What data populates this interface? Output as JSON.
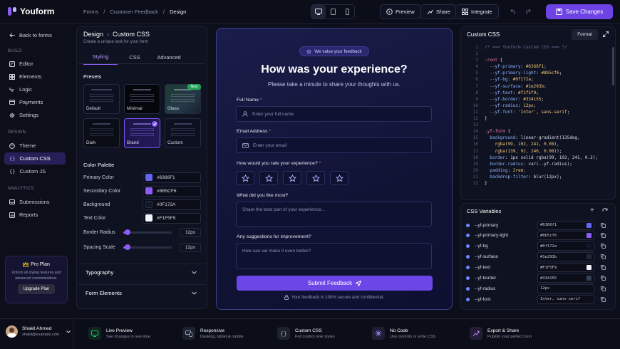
{
  "app": {
    "name": "Youform"
  },
  "breadcrumb": [
    "Forms",
    "Customer Feedback",
    "Design"
  ],
  "toolbar": {
    "preview": "Preview",
    "share": "Share",
    "integrate": "Integrate",
    "save": "Save Changes"
  },
  "sidebar": {
    "back": "Back to forms",
    "sections": {
      "build": "BUILD",
      "design": "DESIGN",
      "analytics": "ANALYTICS"
    },
    "build_items": [
      {
        "label": "Editor",
        "icon": "pencil-icon"
      },
      {
        "label": "Elements",
        "icon": "elements-icon"
      },
      {
        "label": "Logic",
        "icon": "logic-icon"
      },
      {
        "label": "Payments",
        "icon": "card-icon"
      },
      {
        "label": "Settings",
        "icon": "gear-icon"
      }
    ],
    "design_items": [
      {
        "label": "Theme",
        "icon": "palette-icon"
      },
      {
        "label": "Custom CSS",
        "icon": "braces-icon",
        "active": true
      },
      {
        "label": "Custom JS",
        "icon": "code-icon"
      }
    ],
    "analytics_items": [
      {
        "label": "Submissions",
        "icon": "inbox-icon"
      },
      {
        "label": "Reports",
        "icon": "reports-icon"
      }
    ],
    "pro": {
      "title": "Pro Plan",
      "desc1": "Unlock all styling features and",
      "desc2": "advanced customizations.",
      "button": "Upgrade Plan"
    },
    "user": {
      "name": "Shakil Ahmed",
      "email": "shakil@example.com"
    }
  },
  "design": {
    "crumb": "Design",
    "title": "Custom CSS",
    "subtitle": "Create a unique look for your form",
    "tabs": [
      "Styling",
      "CSS",
      "Advanced"
    ],
    "presets_label": "Presets",
    "presets": [
      {
        "name": "Default"
      },
      {
        "name": "Minimal"
      },
      {
        "name": "Glass",
        "badge": "New"
      },
      {
        "name": "Dark"
      },
      {
        "name": "Brand",
        "selected": true
      },
      {
        "name": "Custom"
      }
    ],
    "palette_label": "Color Palette",
    "colors": [
      {
        "name": "Primary Color",
        "hex": "#6366F1"
      },
      {
        "name": "Secondary Color",
        "hex": "#8B5CF6"
      },
      {
        "name": "Background",
        "hex": "#0F172A"
      },
      {
        "name": "Text Color",
        "hex": "#F1F5F9"
      }
    ],
    "border_radius": {
      "label": "Border Radius",
      "value": "12px",
      "fraction": 0.05
    },
    "spacing_scale": {
      "label": "Spacing Scale",
      "value": "12px",
      "fraction": 0.05
    },
    "accordions": [
      "Typography",
      "Form Elements"
    ]
  },
  "form": {
    "pill": "We value your feedback",
    "title": "How was your experience?",
    "subtitle": "Please take a minute to share your thoughts with us.",
    "name_label": "Full Name",
    "name_placeholder": "Enter your full name",
    "email_label": "Email Address",
    "email_placeholder": "Enter your email",
    "rating_label": "How would you rate your experience?",
    "rating_max": 5,
    "like_label": "What did you like most?",
    "like_placeholder": "Share the best part of your experience...",
    "improve_label": "Any suggestions for improvement?",
    "improve_placeholder": "How can we make it even better?",
    "submit": "Submit Feedback",
    "secure": "Your feedback is 100% secure and confidential.",
    "required": "*"
  },
  "css_panel": {
    "title": "Custom CSS",
    "format": "Format",
    "lines": [
      [
        {
          "t": "cm",
          "v": "/* === Youform Custom CSS === */"
        }
      ],
      [],
      [
        {
          "t": "sel",
          "v": ":root"
        },
        {
          "t": "pl",
          "v": " {"
        }
      ],
      [
        {
          "t": "prop",
          "v": "  --yf-primary"
        },
        {
          "t": "pl",
          "v": ": "
        },
        {
          "t": "val",
          "v": "#6366f1"
        },
        {
          "t": "pl",
          "v": ";"
        }
      ],
      [
        {
          "t": "prop",
          "v": "  --yf-primary-light"
        },
        {
          "t": "pl",
          "v": ": "
        },
        {
          "t": "val",
          "v": "#8b5cf6"
        },
        {
          "t": "pl",
          "v": ";"
        }
      ],
      [
        {
          "t": "prop",
          "v": "  --yf-bg"
        },
        {
          "t": "pl",
          "v": ": "
        },
        {
          "t": "val",
          "v": "#0f172a"
        },
        {
          "t": "pl",
          "v": ";"
        }
      ],
      [
        {
          "t": "prop",
          "v": "  --yf-surface"
        },
        {
          "t": "pl",
          "v": ": "
        },
        {
          "t": "val",
          "v": "#1e293b"
        },
        {
          "t": "pl",
          "v": ";"
        }
      ],
      [
        {
          "t": "prop",
          "v": "  --yf-text"
        },
        {
          "t": "pl",
          "v": ": "
        },
        {
          "t": "val",
          "v": "#f1f5f9"
        },
        {
          "t": "pl",
          "v": ";"
        }
      ],
      [
        {
          "t": "prop",
          "v": "  --yf-border"
        },
        {
          "t": "pl",
          "v": ": "
        },
        {
          "t": "val",
          "v": "#334155"
        },
        {
          "t": "pl",
          "v": ";"
        }
      ],
      [
        {
          "t": "prop",
          "v": "  --yf-radius"
        },
        {
          "t": "pl",
          "v": ": "
        },
        {
          "t": "val",
          "v": "12px"
        },
        {
          "t": "pl",
          "v": ";"
        }
      ],
      [
        {
          "t": "prop",
          "v": "  --yf-font"
        },
        {
          "t": "pl",
          "v": ": "
        },
        {
          "t": "val",
          "v": "'Inter', sans-serif"
        },
        {
          "t": "pl",
          "v": ";"
        }
      ],
      [
        {
          "t": "pl",
          "v": "}"
        }
      ],
      [],
      [
        {
          "t": "sel",
          "v": ".yf-form"
        },
        {
          "t": "pl",
          "v": " {"
        }
      ],
      [
        {
          "t": "prop",
          "v": "  background"
        },
        {
          "t": "pl",
          "v": ": linear-gradient(135deg,"
        }
      ],
      [
        {
          "t": "pl",
          "v": "    "
        },
        {
          "t": "val",
          "v": "rgba(99, 102, 241, 0.08)"
        },
        {
          "t": "pl",
          "v": ","
        }
      ],
      [
        {
          "t": "pl",
          "v": "    "
        },
        {
          "t": "val",
          "v": "rgba(139, 92, 246, 0.08)"
        },
        {
          "t": "pl",
          "v": ");"
        }
      ],
      [
        {
          "t": "prop",
          "v": "  border"
        },
        {
          "t": "pl",
          "v": ": 1px solid rgba(99, 102, 241, 0.2);"
        }
      ],
      [
        {
          "t": "prop",
          "v": "  border-radius"
        },
        {
          "t": "pl",
          "v": ": var(--yf-radius);"
        }
      ],
      [
        {
          "t": "prop",
          "v": "  padding"
        },
        {
          "t": "pl",
          "v": ": "
        },
        {
          "t": "val",
          "v": "2rem"
        },
        {
          "t": "pl",
          "v": ";"
        }
      ],
      [
        {
          "t": "prop",
          "v": "  backdrop-filter"
        },
        {
          "t": "pl",
          "v": ": blur(12px);"
        }
      ],
      [
        {
          "t": "pl",
          "v": "}"
        }
      ]
    ]
  },
  "variables": {
    "title": "CSS Variables",
    "items": [
      {
        "name": "--yf-primary",
        "value": "#6366f1",
        "swatch": "#6366F1"
      },
      {
        "name": "--yf-primary-light",
        "value": "#8b5cf6",
        "swatch": "#8B5CF6"
      },
      {
        "name": "--yf-bg",
        "value": "#0f172a",
        "swatch": "#0F172A"
      },
      {
        "name": "--yf-surface",
        "value": "#1e293b",
        "swatch": "#1E293B"
      },
      {
        "name": "--yf-text",
        "value": "#F1F5F9",
        "swatch": "#F1F5F9"
      },
      {
        "name": "--yf-border",
        "value": "#334155",
        "swatch": "#334155"
      },
      {
        "name": "--yf-radius",
        "value": "12px"
      },
      {
        "name": "--yf-font",
        "value": "Inter, sans-serif"
      }
    ]
  },
  "features": [
    {
      "title": "Live Preview",
      "desc": "See changes in real-time",
      "icon": "monitor-icon",
      "color": "#22c55e"
    },
    {
      "title": "Responsive",
      "desc": "Desktop, tablet & mobile",
      "icon": "devices-icon",
      "color": "#94a3b8"
    },
    {
      "title": "Custom CSS",
      "desc": "Full control over styles",
      "icon": "braces-icon",
      "color": "#94a3b8"
    },
    {
      "title": "No Code",
      "desc": "Use controls or write CSS",
      "icon": "sparkle-icon",
      "color": "#a78bfa"
    },
    {
      "title": "Export & Share",
      "desc": "Publish your perfect form",
      "icon": "share-icon",
      "color": "#c084fc"
    }
  ]
}
